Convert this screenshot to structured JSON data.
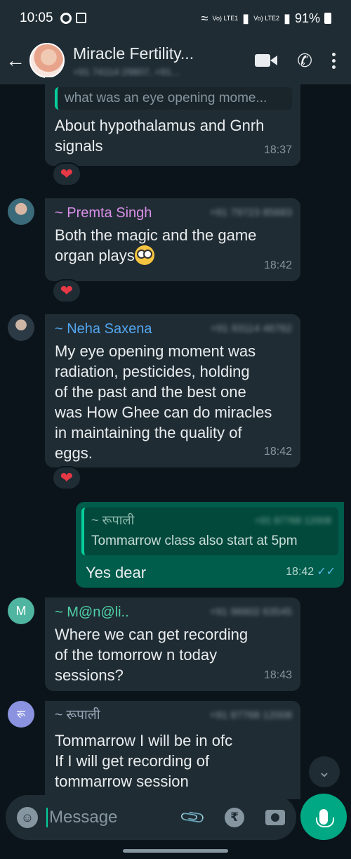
{
  "status_bar": {
    "time": "10:05",
    "network_1": "Vo) LTE1",
    "network_2": "Vo) LTE2",
    "battery": "91%"
  },
  "header": {
    "title": "Miracle Fertility...",
    "subtitle": "+91 74114 29807, +91..."
  },
  "messages": [
    {
      "quote_text": "what was an eye opening mome...",
      "text_line1": "About hypothalamus and Gnrh",
      "text_line2": "signals",
      "time": "18:37",
      "reaction": "❤"
    },
    {
      "sender": "~ Premta Singh",
      "sender_phone": "+91 79723 85683",
      "sender_color": "#d98ee8",
      "text_line1": "Both the magic and the game",
      "text_line2": "organ plays",
      "time": "18:42",
      "reaction": "❤"
    },
    {
      "sender": "~ Neha Saxena",
      "sender_phone": "+91 93114 46762",
      "sender_color": "#53a6f0",
      "lines": [
        "My eye opening moment was",
        "radiation, pesticides,  holding",
        "of the past and the best one",
        "was How Ghee can do miracles",
        "in maintaining the quality of",
        "eggs."
      ],
      "time": "18:42",
      "reaction": "❤"
    },
    {
      "quote_sender": "~ रूपाली",
      "quote_phone": "+91 87768 12008",
      "quote_text": "Tommarrow class also start at 5pm",
      "text": "Yes dear",
      "time": "18:42",
      "ticks": "✓✓"
    },
    {
      "avatar_letter": "M",
      "avatar_color": "#4fb5a0",
      "sender": "~ M@n@li..",
      "sender_phone": "+91 96602 63545",
      "sender_color": "#4fd1a8",
      "lines": [
        "Where we can get recording",
        "of the tomorrow n today",
        "sessions?"
      ],
      "time": "18:43"
    },
    {
      "avatar_letter": "रू",
      "avatar_color": "#8b93e0",
      "sender": "~ रूपाली",
      "sender_phone": "+91 87768 12008",
      "sender_color": "#9aa6b8",
      "lines": [
        "Tommarrow I will be in ofc",
        "If I will get recording of",
        "tommarrow session"
      ]
    }
  ],
  "input": {
    "placeholder": "Message"
  },
  "colors": {
    "background": "#0b141a",
    "header": "#1f2c34",
    "incoming_bubble": "#202c33",
    "outgoing_bubble": "#005c4b",
    "accent": "#00a884"
  }
}
